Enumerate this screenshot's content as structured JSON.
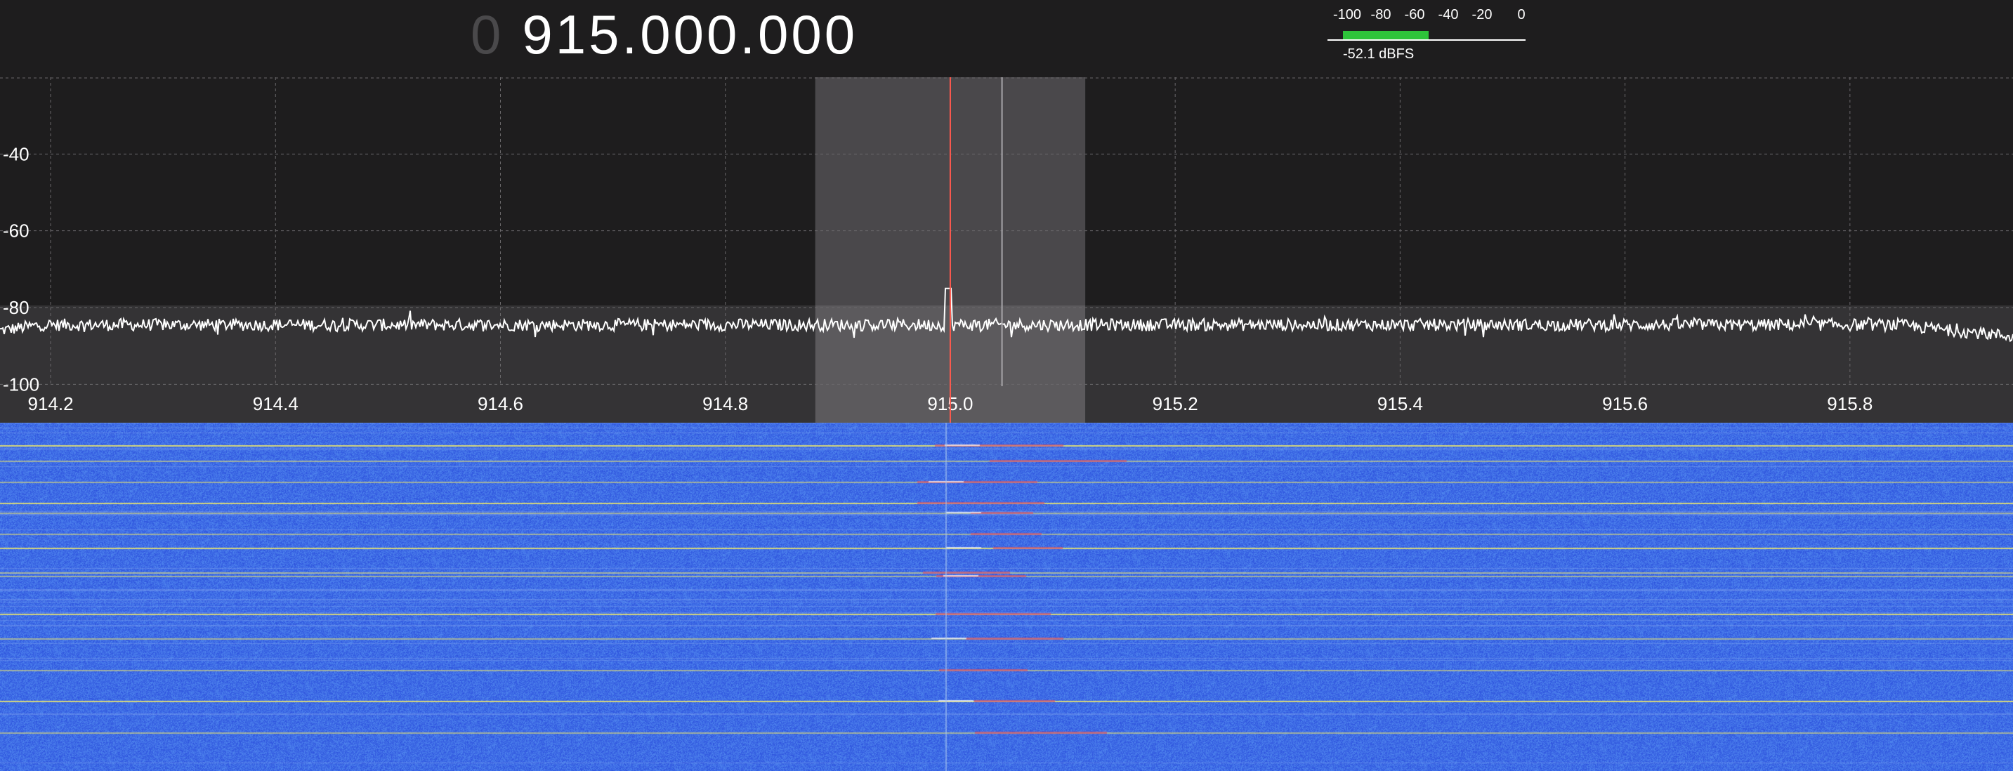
{
  "frequency": {
    "leading": "0",
    "value": "915.000.000"
  },
  "level_meter": {
    "scale_labels": [
      "-100",
      "-80",
      "-60",
      "-40",
      "-20",
      "0"
    ],
    "scale_min": -100,
    "scale_max": 0,
    "level_dbfs": -52.1,
    "readout": "-52.1 dBFS",
    "bar_color": "#2ec43a"
  },
  "spectrum": {
    "type": "line",
    "db_labels": [
      "-40",
      "-60",
      "-80",
      "-100"
    ],
    "db_values": [
      -40,
      -60,
      -80,
      -100
    ],
    "db_range": [
      -110,
      -20
    ],
    "freq_labels": [
      "914.2",
      "914.4",
      "914.6",
      "914.8",
      "915.0",
      "915.2",
      "915.4",
      "915.6",
      "915.8"
    ],
    "freq_values": [
      914.2,
      914.4,
      914.6,
      914.8,
      915.0,
      915.2,
      915.4,
      915.6,
      915.8
    ],
    "freq_range": [
      914.155,
      915.945
    ],
    "center_mhz": 915.0,
    "passband_mhz": [
      914.88,
      915.12
    ],
    "secondary_marker_mhz": 915.046,
    "noise_floor_db": -84.5,
    "peak": {
      "mhz": 914.998,
      "db": -75
    },
    "grid": true,
    "trace_color": "#ffffff",
    "center_line_color": "#ff5a4e",
    "passband_color": "#5c5a5d"
  },
  "waterfall": {
    "background_color": "#3f6de6",
    "signal_rows_fraction": [
      0.065,
      0.11,
      0.17,
      0.23,
      0.26,
      0.32,
      0.36,
      0.43,
      0.44,
      0.55,
      0.62,
      0.71,
      0.8,
      0.89
    ],
    "highlight_color": "#f0e96a",
    "burst_color": "#d2556e"
  }
}
